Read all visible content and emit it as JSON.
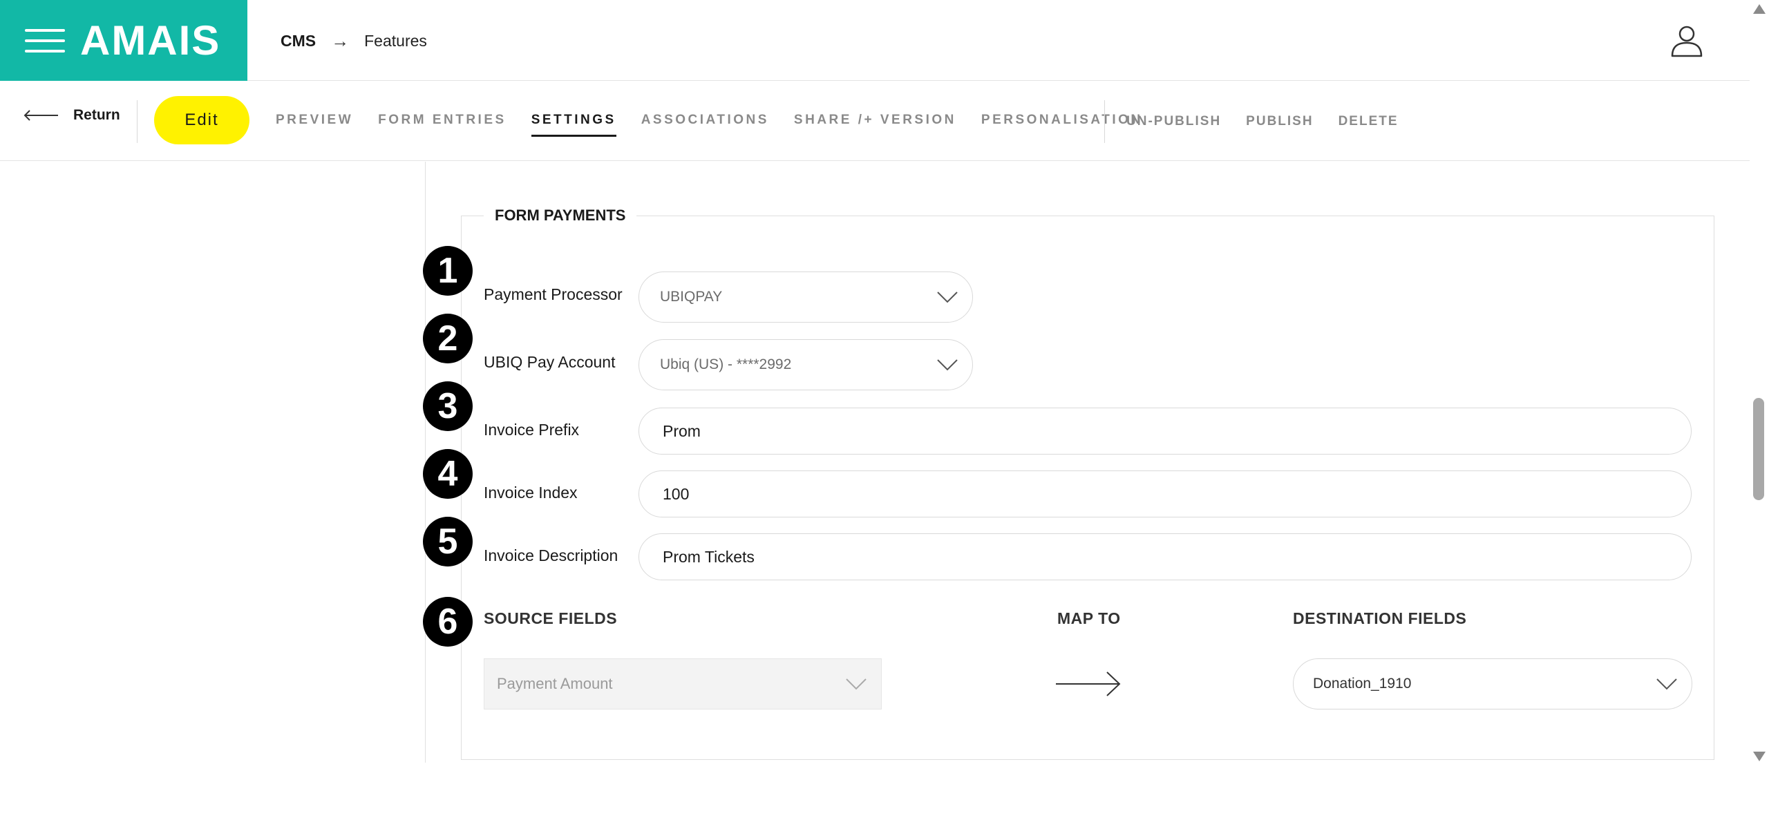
{
  "header": {
    "logo": "AMAIS",
    "breadcrumb": {
      "root": "CMS",
      "separator": "→",
      "current": "Features"
    }
  },
  "toolbar": {
    "return_label": "Return",
    "edit_label": "Edit",
    "tabs": [
      "PREVIEW",
      "FORM ENTRIES",
      "SETTINGS",
      "ASSOCIATIONS",
      "SHARE /+ VERSION",
      "PERSONALISATION"
    ],
    "active_tab": "SETTINGS",
    "actions": [
      "UN-PUBLISH",
      "PUBLISH",
      "DELETE"
    ]
  },
  "form": {
    "title": "FORM PAYMENTS",
    "badges": [
      "1",
      "2",
      "3",
      "4",
      "5",
      "6"
    ],
    "payment_processor": {
      "label": "Payment Processor",
      "value": "UBIQPAY"
    },
    "pay_account": {
      "label": "UBIQ Pay Account",
      "value": "Ubiq (US) - ****2992"
    },
    "invoice_prefix": {
      "label": "Invoice Prefix",
      "value": "Prom"
    },
    "invoice_index": {
      "label": "Invoice Index",
      "value": "100"
    },
    "invoice_description": {
      "label": "Invoice Description",
      "value": "Prom Tickets"
    },
    "mapping": {
      "source_header": "SOURCE FIELDS",
      "map_header": "MAP TO",
      "destination_header": "DESTINATION FIELDS",
      "source_value": "Payment Amount",
      "destination_value": "Donation_1910"
    }
  },
  "colors": {
    "brand": "#12b8a6",
    "edit_button": "#fff200",
    "text_dark": "#1a1a1a",
    "text_muted": "#8a8a8a",
    "border": "#d9d9d9"
  },
  "icons": [
    "hamburger-icon",
    "user-icon",
    "arrow-left-icon",
    "chevron-down-icon",
    "arrow-right-icon"
  ]
}
